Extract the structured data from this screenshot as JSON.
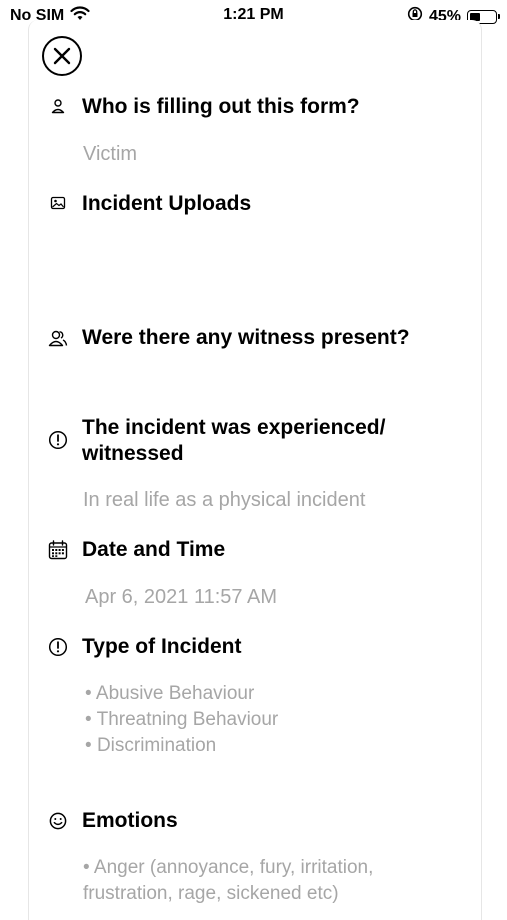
{
  "status_bar": {
    "carrier": "No SIM",
    "time": "1:21 PM",
    "battery": "45%",
    "battery_level": 0.45
  },
  "form": {
    "sections": [
      {
        "icon": "person-icon",
        "title": "Who is filling out this form?",
        "value": "Victim"
      },
      {
        "icon": "image-icon",
        "title": "Incident Uploads"
      },
      {
        "icon": "people-icon",
        "title": "Were there any witness present?"
      },
      {
        "icon": "alert-circle-icon",
        "title_line1": "The incident was experienced/",
        "title_line2": "witnessed",
        "value": "In real life as a physical incident"
      },
      {
        "icon": "calendar-icon",
        "title": "Date and Time",
        "value": "Apr 6, 2021 11:57 AM"
      },
      {
        "icon": "alert-circle-icon",
        "title": "Type of Incident",
        "items": [
          "Abusive Behaviour",
          "Threatning Behaviour",
          "Discrimination"
        ]
      },
      {
        "icon": "smiley-icon",
        "title": "Emotions",
        "items_text": [
          "Anger (annoyance, fury, irritation,",
          "frustration, rage, sickened etc)"
        ]
      }
    ]
  }
}
